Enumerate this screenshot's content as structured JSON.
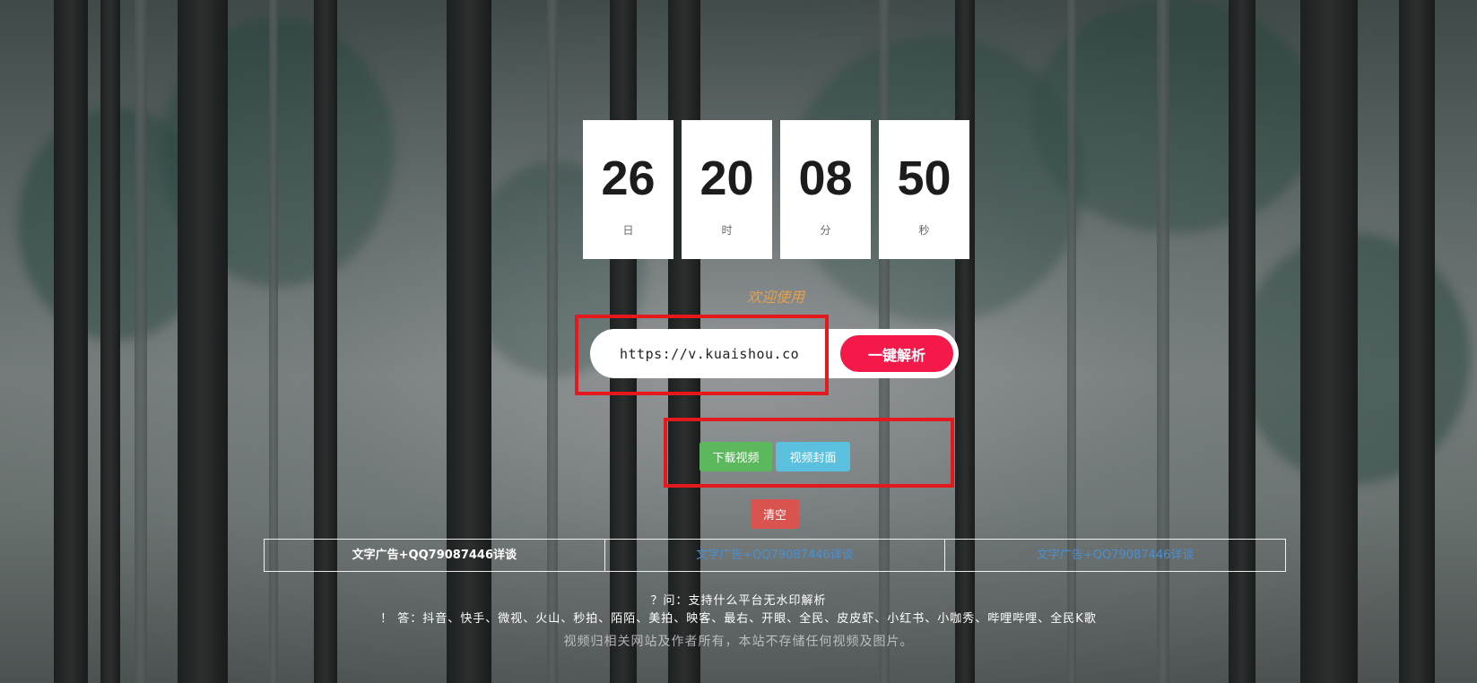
{
  "countdown": [
    {
      "value": "26",
      "unit": "日"
    },
    {
      "value": "20",
      "unit": "时"
    },
    {
      "value": "08",
      "unit": "分"
    },
    {
      "value": "50",
      "unit": "秒"
    }
  ],
  "welcome_text": "欢迎使用",
  "url_input": {
    "value": "https://v.kuaishou.co",
    "placeholder": ""
  },
  "parse_button": "一键解析",
  "download_video_button": "下载视频",
  "video_cover_button": "视频封面",
  "clear_button": "清空",
  "ads": [
    "文字广告+QQ79087446详谈",
    "文字广告+QQ79087446详谈",
    "文字广告+QQ79087446详谈"
  ],
  "faq": {
    "question": "？问：支持什么平台无水印解析",
    "answer": "！ 答：抖音、快手、微视、火山、秒拍、陌陌、美拍、映客、最右、开眼、全民、皮皮虾、小红书、小咖秀、哔哩哔哩、全民K歌",
    "note": "视频归相关网站及作者所有，本站不存储任何视频及图片。"
  },
  "colors": {
    "parse_button": "#f5194a",
    "download_button": "#5cb85c",
    "cover_button": "#5bc0de",
    "clear_button": "#d9534f",
    "highlight_box": "#e3191e",
    "welcome_text": "#e6a04a"
  }
}
